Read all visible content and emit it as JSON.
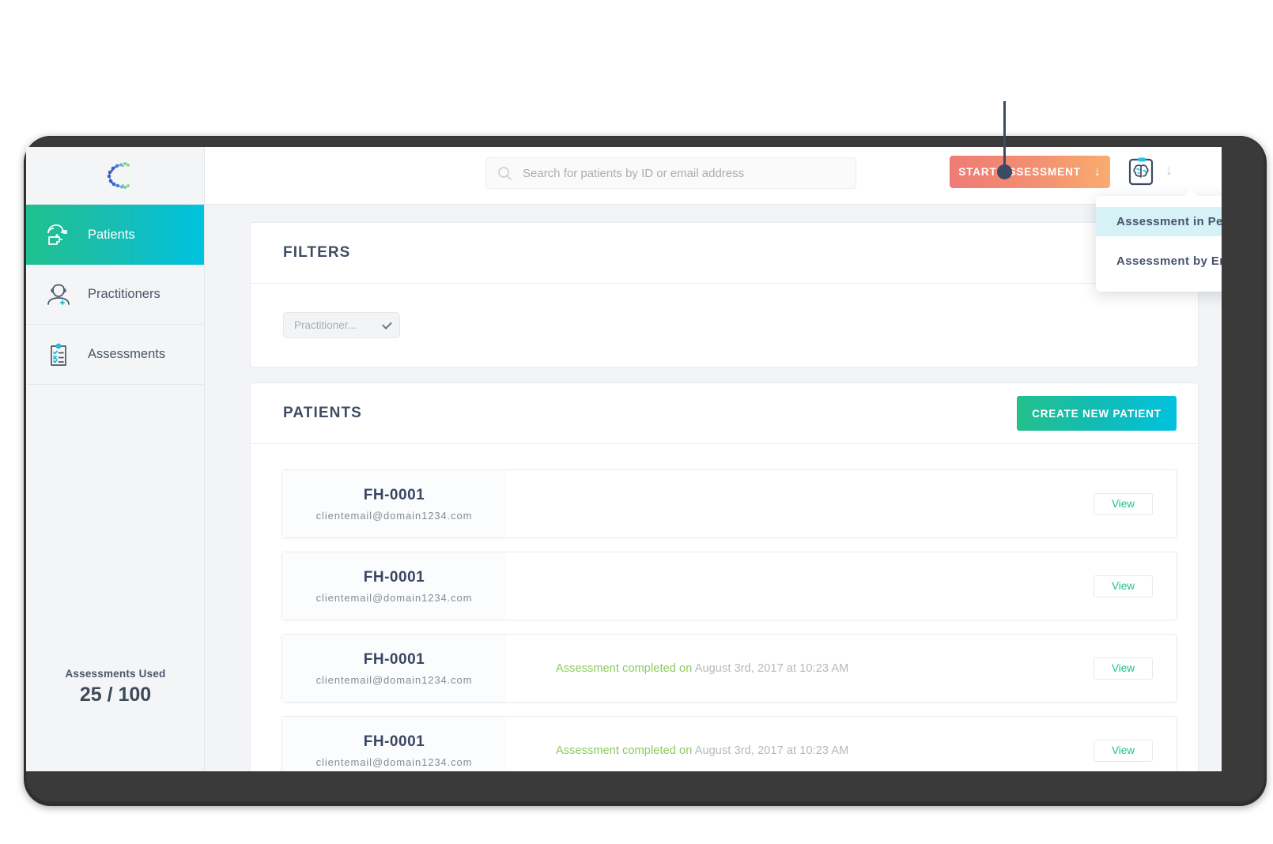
{
  "sidebar": {
    "logo_icon": "molecular-c-logo",
    "items": [
      {
        "label": "Patients",
        "icon": "head-profile-icon",
        "active": true
      },
      {
        "label": "Practitioners",
        "icon": "person-plus-icon",
        "active": false
      },
      {
        "label": "Assessments",
        "icon": "clipboard-checklist-icon",
        "active": false
      }
    ],
    "footer": {
      "label": "Assessments Used",
      "value": "25 / 100"
    }
  },
  "topbar": {
    "search": {
      "placeholder": "Search for patients by ID or email address",
      "value": "",
      "icon": "search-icon"
    },
    "start_assessment": {
      "label": "START ASSESSMENT",
      "arrow": "↓",
      "color_from": "#ef7b76",
      "color_to": "#f9ac6f"
    },
    "brain_icon": "brain-clipboard-icon",
    "side_arrow": "↓"
  },
  "dropdown": {
    "items": [
      {
        "label": "Assessment in Person",
        "highlighted": true
      },
      {
        "label": "Assessment by Email",
        "highlighted": false
      }
    ]
  },
  "filters": {
    "title": "FILTERS",
    "practitioner_select": {
      "value": "Practitioner...",
      "icon": "chevron-down-icon"
    }
  },
  "patients": {
    "title": "PATIENTS",
    "create_button": "CREATE NEW PATIENT",
    "view_button": "View",
    "rows": [
      {
        "id": "FH-0001",
        "email": "clientemail@domain1234.com",
        "status_label": "",
        "status_date": ""
      },
      {
        "id": "FH-0001",
        "email": "clientemail@domain1234.com",
        "status_label": "",
        "status_date": ""
      },
      {
        "id": "FH-0001",
        "email": "clientemail@domain1234.com",
        "status_label": "Assessment completed on",
        "status_date": "August 3rd, 2017 at 10:23 AM"
      },
      {
        "id": "FH-0001",
        "email": "clientemail@domain1234.com",
        "status_label": "Assessment completed on",
        "status_date": "August 3rd, 2017 at 10:23 AM"
      }
    ]
  },
  "colors": {
    "accent_teal": "#00c2e0",
    "accent_green": "#1fc08f",
    "navy": "#3f4c63",
    "status_green": "#8bc95e",
    "orange_from": "#ef7b76",
    "orange_to": "#f9ac6f",
    "highlight": "#d6f2f7"
  }
}
